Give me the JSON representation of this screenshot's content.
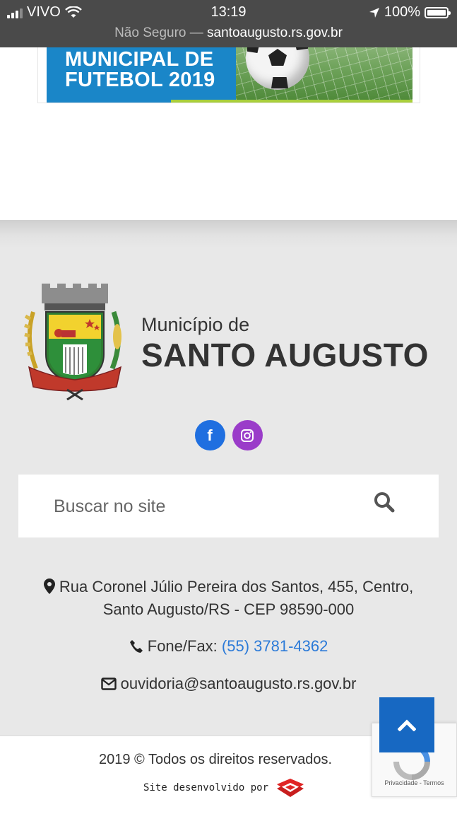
{
  "status_bar": {
    "carrier": "VIVO",
    "time": "13:19",
    "battery": "100%"
  },
  "url_bar": {
    "security": "Não Seguro",
    "separator": " — ",
    "domain": "santoaugusto.rs.gov.br"
  },
  "banner": {
    "title": "MUNICIPAL DE\nFUTEBOL 2019"
  },
  "footer": {
    "logo": {
      "line1": "Município de",
      "line2": "SANTO AUGUSTO"
    },
    "social": [
      {
        "name": "facebook-icon",
        "glyph": "f"
      },
      {
        "name": "instagram-icon"
      }
    ],
    "search": {
      "placeholder": "Buscar no site"
    },
    "address": {
      "line1": "Rua Coronel Júlio Pereira dos Santos, 455, Centro,",
      "line2": "Santo Augusto/RS - CEP 98590-000"
    },
    "phone": {
      "label": "Fone/Fax:",
      "number": "(55) 3781-4362"
    },
    "email": "ouvidoria@santoaugusto.rs.gov.br"
  },
  "bottom": {
    "copyright": "2019 © Todos os direitos reservados.",
    "developed_by": "Site desenvolvido por"
  },
  "recaptcha": {
    "text": "Privacidade - Termos"
  },
  "colors": {
    "accent_blue": "#1768c2",
    "facebook": "#1f6fe0",
    "instagram": "#9a3cc9",
    "link": "#2b7ad8"
  }
}
